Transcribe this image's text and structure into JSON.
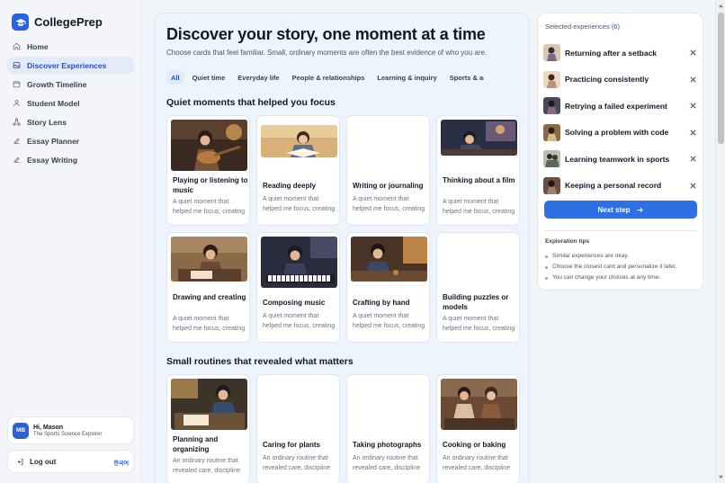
{
  "app": {
    "name": "CollegePrep"
  },
  "nav": [
    {
      "label": "Home",
      "icon": "home-icon"
    },
    {
      "label": "Discover Experiences",
      "icon": "image-icon",
      "active": true
    },
    {
      "label": "Growth Timeline",
      "icon": "calendar-icon"
    },
    {
      "label": "Student Model",
      "icon": "user-icon"
    },
    {
      "label": "Story Lens",
      "icon": "nodes-icon"
    },
    {
      "label": "Essay Planner",
      "icon": "pen-icon"
    },
    {
      "label": "Essay Writing",
      "icon": "pen-icon"
    }
  ],
  "user": {
    "initials": "MB",
    "greeting": "Hi, Mason",
    "subtitle": "The Sports Science Explorer"
  },
  "logout": {
    "label": "Log out",
    "language": "한국어"
  },
  "main": {
    "title": "Discover your story, one moment at a time",
    "subtitle": "Choose cards that feel familiar. Small, ordinary moments are often the best evidence of who you are.",
    "filters": [
      "All",
      "Quiet time",
      "Everyday life",
      "People & relationships",
      "Learning & inquiry",
      "Sports & activities"
    ],
    "active_filter": "All",
    "sections": [
      {
        "title": "Quiet moments that helped you focus",
        "cards": [
          {
            "title": "Playing or listening to music",
            "description": "A quiet moment that helped me focus, creating space to think."
          },
          {
            "title": "Reading deeply",
            "description": "A quiet moment that helped me focus, creating space to think."
          },
          {
            "title": "Writing or journaling",
            "description": "A quiet moment that helped me focus, creating space to think."
          },
          {
            "title": "Thinking about a film",
            "description": "A quiet moment that helped me focus, creating space to think."
          },
          {
            "title": "Drawing and creating",
            "description": "A quiet moment that helped me focus, creating space to think."
          },
          {
            "title": "Composing music",
            "description": "A quiet moment that helped me focus, creating space to think."
          },
          {
            "title": "Crafting by hand",
            "description": "A quiet moment that helped me focus, creating space to think."
          },
          {
            "title": "Building puzzles or models",
            "description": "A quiet moment that helped me focus, creating space to think."
          }
        ]
      },
      {
        "title": "Small routines that revealed what matters",
        "cards": [
          {
            "title": "Planning and organizing",
            "description": "An ordinary routine that revealed care, discipline and values."
          },
          {
            "title": "Caring for plants",
            "description": "An ordinary routine that revealed care, discipline and values."
          },
          {
            "title": "Taking photographs",
            "description": "An ordinary routine that revealed care, discipline and values."
          },
          {
            "title": "Cooking or baking",
            "description": "An ordinary routine that revealed care, discipline and values."
          }
        ]
      }
    ]
  },
  "selected": {
    "label": "Selected experiences",
    "count": "(6)",
    "items": [
      {
        "label": "Returning after a setback"
      },
      {
        "label": "Practicing consistently"
      },
      {
        "label": "Retrying a failed experiment"
      },
      {
        "label": "Solving a problem with code"
      },
      {
        "label": "Learning teamwork in sports"
      },
      {
        "label": "Keeping a personal record"
      }
    ],
    "next_label": "Next step"
  },
  "tips": {
    "title": "Exploration tips",
    "items": [
      "Similar experiences are okay.",
      "Choose the closest card and personalize it later.",
      "You can change your choices at any time."
    ]
  },
  "colors": {
    "accent": "#2f6fe6",
    "active_nav": "#e3ebfb",
    "brand": "#2563eb"
  }
}
